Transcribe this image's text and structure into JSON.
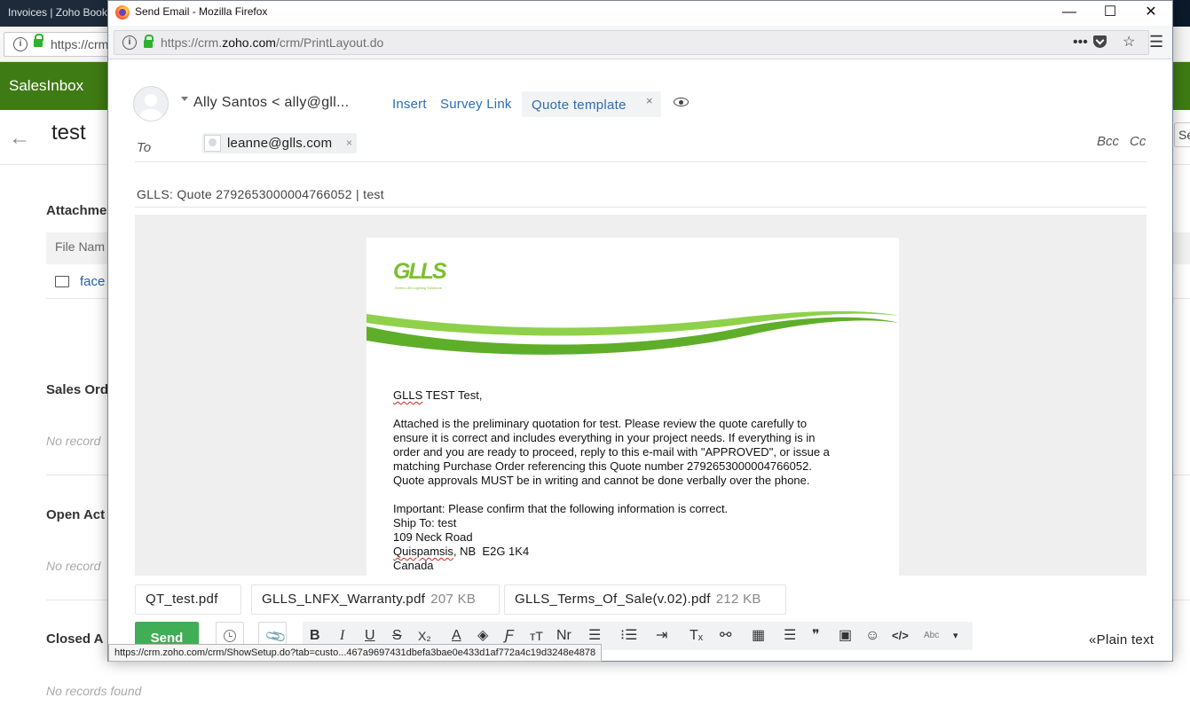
{
  "background": {
    "tab_title": "Invoices | Zoho Book",
    "url_partial": "https://crm",
    "brand": "SalesInbox",
    "back_icon": "back-arrow-icon",
    "record_title": "test",
    "right_button_partial": "Se",
    "attachments_heading": "Attachme",
    "file_name_header": "File Nam",
    "file_link_partial": "face",
    "sections": [
      {
        "heading": "Sales Ord",
        "empty": "No record"
      },
      {
        "heading": "Open Act",
        "empty": "No record"
      },
      {
        "heading": "Closed A",
        "empty": "No records found"
      }
    ]
  },
  "window": {
    "title": "Send Email - Mozilla Firefox",
    "url_prefix": "https://crm.",
    "url_domain": "zoho.com",
    "url_path": "/crm/PrintLayout.do",
    "minimize": "—",
    "maximize": "☐",
    "close": "✕",
    "more_glyph": "•••",
    "star_glyph": "☆",
    "menu_glyph": "☰"
  },
  "composer": {
    "from": "Ally Santos < ally@gll...",
    "insert_label": "Insert",
    "survey_label": "Survey Link",
    "template_label": "Quote template",
    "template_close": "×",
    "to_label": "To",
    "recipient": "leanne@glls.com",
    "recipient_close": "×",
    "bcc_label": "Bcc",
    "cc_label": "Cc",
    "subject": "GLLS: Quote 2792653000004766052 | test"
  },
  "letter": {
    "logo_text": "GLLS",
    "logo_tagline": "Green LED Lighting Solutions",
    "greeting_name": "GLLS",
    "greeting_rest": " TEST Test,",
    "para1": [
      "Attached is the preliminary quotation for test. Please review the quote carefully to",
      "ensure it is correct and includes everything in your project needs. If everything is in",
      "order and you are ready to proceed, reply to this e-mail with \"APPROVED\", or issue a",
      "matching Purchase Order referencing this Quote number 2792653000004766052.",
      "Quote approvals MUST be in writing and cannot be done verbally over the phone."
    ],
    "important": "Important: Please confirm that the following information is correct.",
    "ship_to": "Ship To: test",
    "address1": "109 Neck Road",
    "city": "Quispamsis",
    "city_rest": ", NB  E2G 1K4",
    "country": "Canada"
  },
  "attachments": [
    {
      "name": "QT_test.pdf",
      "size": ""
    },
    {
      "name": "GLLS_LNFX_Warranty.pdf",
      "size": "207 KB"
    },
    {
      "name": "GLLS_Terms_Of_Sale(v.02).pdf",
      "size": "212 KB"
    }
  ],
  "toolbar": {
    "send_label": "Send",
    "bold": "B",
    "italic": "I",
    "underline": "U",
    "strike": "S",
    "subscript": "X₂",
    "font_color": "A",
    "fill": "◈",
    "font_family": "Ƒ",
    "font_size": "тT",
    "normal": "Nr",
    "align": "☰",
    "bullets": "⁝☰",
    "indent": "⇥",
    "clear": "Tₓ",
    "link": "⚯",
    "table": "▦",
    "hrule": "☰",
    "quote": "❞",
    "image": "▣",
    "emoji": "☺",
    "code": "</>",
    "spell": "Abc",
    "more": "▾",
    "plain_text": "«Plain text"
  },
  "status_url": "https://crm.zoho.com/crm/ShowSetup.do?tab=custo...467a9697431dbefa3bae0e433d1af772a4c19d3248e4878",
  "colors": {
    "brand_green": "#3f7b14",
    "send_green": "#3fae56",
    "link_blue": "#2e6db4",
    "logo_green": "#7cbf2c"
  }
}
